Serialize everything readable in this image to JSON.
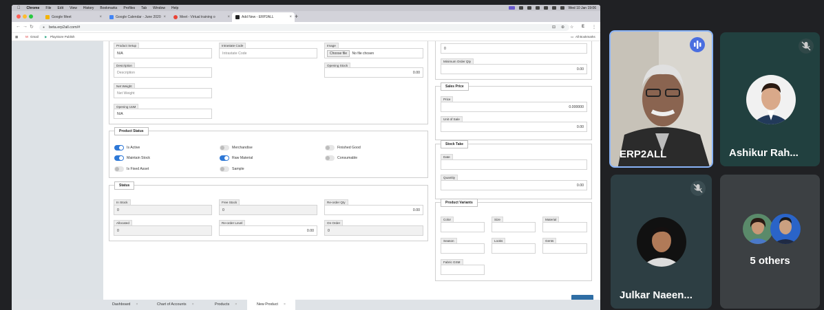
{
  "browser": {
    "menubar": {
      "app": "Chrome",
      "items": [
        "File",
        "Edit",
        "View",
        "History",
        "Bookmarks",
        "Profiles",
        "Tab",
        "Window",
        "Help"
      ],
      "clock": "Wed 10 Jan 19:06"
    },
    "tabs": [
      {
        "label": "Google Meet",
        "color": "#f4b400"
      },
      {
        "label": "Google Calendar - June 2020",
        "color": "#4285f4"
      },
      {
        "label": "Meet - Virtual training o",
        "color": "#ea4335"
      },
      {
        "label": "Add New - ERP2ALL",
        "color": "#222222"
      }
    ],
    "url": "beta.erp2all.com/#",
    "bookmarks": [
      "Gmail",
      "PlayStore Publish"
    ],
    "all_bookmarks": "All Bookmarks"
  },
  "form": {
    "left_top": {
      "product_setup_label": "Product Setup",
      "product_setup_value": "N/A",
      "description_label": "Description",
      "description_placeholder": "Description",
      "net_weight_label": "Net Weight",
      "net_weight_placeholder": "Net Weight",
      "opening_uom_label": "Opening UoM",
      "opening_uom_value": "N/A"
    },
    "middle_top": {
      "intrastate_code_label": "Intrastate Code",
      "intrastate_code_placeholder": "Intrastate Code"
    },
    "right_top": {
      "image_label": "Image",
      "choose_file": "Choose file",
      "no_file": "No file chosen",
      "opening_stock_label": "Opening Stock",
      "opening_stock_value": "0.00"
    },
    "product_status": {
      "title": "Product Status",
      "toggles": [
        {
          "label": "Is Active",
          "on": true
        },
        {
          "label": "Merchandise",
          "on": false
        },
        {
          "label": "Finished Good",
          "on": false
        },
        {
          "label": "Maintain Stock",
          "on": true
        },
        {
          "label": "Raw Material",
          "on": true
        },
        {
          "label": "Consumable",
          "on": false
        },
        {
          "label": "Is Fixed Asset",
          "on": false
        },
        {
          "label": "Sample",
          "on": false
        }
      ]
    },
    "status": {
      "title": "Status",
      "in_stock_label": "In Stock",
      "in_stock_value": "0",
      "free_stock_label": "Free Stock",
      "free_stock_value": "0",
      "reorder_qty_label": "Re-order Qty",
      "reorder_qty_value": "0.00",
      "allocated_label": "Allocated",
      "allocated_value": "0",
      "reorder_level_label": "Re-order Level",
      "reorder_level_value": "0.00",
      "on_order_label": "On Order",
      "on_order_value": "0"
    },
    "right_column": {
      "top_value": "0",
      "min_order_label": "Minimum Order Qty",
      "min_order_value": "0.00",
      "sales_price_title": "Sales Price",
      "price_label": "Price",
      "price_value": "0.000000",
      "unit_of_sale_label": "Unit of Sale",
      "unit_of_sale_value": "0.00",
      "stock_take_title": "Stock Take",
      "date_label": "Date",
      "quantity_label": "Quantity",
      "quantity_value": "0.00",
      "variants_title": "Product Variants",
      "color_label": "Color",
      "size_label": "Size",
      "material_label": "Material",
      "season_label": "Season",
      "looks_label": "Looks",
      "gents_label": "Gents",
      "fabric_gsm_label": "Fabric GSM"
    }
  },
  "bottom_tabs": [
    {
      "label": "Dashboard"
    },
    {
      "label": "Chart of Accounts"
    },
    {
      "label": "Products"
    },
    {
      "label": "New Product"
    }
  ],
  "meet": {
    "tiles": [
      {
        "name": "ERP2ALL",
        "speaking": true
      },
      {
        "name": "Ashikur Rah...",
        "muted": true
      },
      {
        "name": "Julkar Naeen...",
        "muted": true
      },
      {
        "name": "5 others"
      }
    ]
  }
}
